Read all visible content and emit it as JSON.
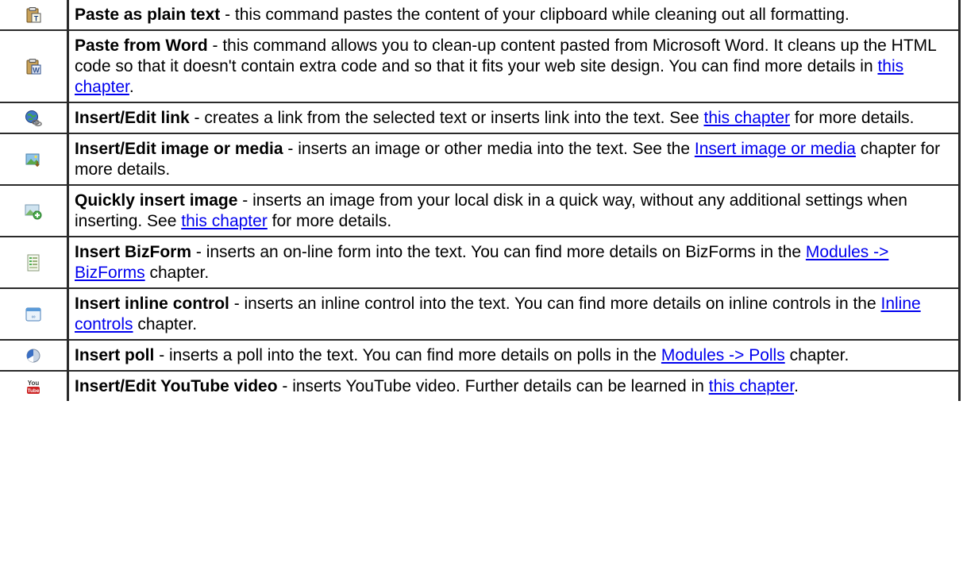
{
  "rows": [
    {
      "icon": "paste-plain-text-icon",
      "title": "Paste as plain text",
      "segments": [
        {
          "t": " - this command pastes the content of your clipboard while cleaning out all formatting."
        }
      ]
    },
    {
      "icon": "paste-from-word-icon",
      "title": "Paste from Word",
      "segments": [
        {
          "t": " - this command allows you to clean-up content pasted from Microsoft Word. It cleans up the HTML code so that it doesn't contain extra code and so that it fits your web site design. You can find more details in "
        },
        {
          "link": "this chapter"
        },
        {
          "t": "."
        }
      ]
    },
    {
      "icon": "insert-link-icon",
      "title": "Insert/Edit link",
      "segments": [
        {
          "t": " - creates a link from the selected text or inserts link into the text. See "
        },
        {
          "link": "this chapter"
        },
        {
          "t": " for more details."
        }
      ]
    },
    {
      "icon": "insert-image-media-icon",
      "title": "Insert/Edit image or media",
      "segments": [
        {
          "t": " - inserts an image or other media into the text. See the "
        },
        {
          "link": "Insert image or media"
        },
        {
          "t": " chapter for more details."
        }
      ]
    },
    {
      "icon": "quick-insert-image-icon",
      "title": "Quickly insert image",
      "segments": [
        {
          "t": " - inserts an image from your local disk in a quick way, without any additional settings when inserting. See "
        },
        {
          "link": "this chapter"
        },
        {
          "t": " for more details."
        }
      ]
    },
    {
      "icon": "bizform-icon",
      "title": "Insert BizForm",
      "segments": [
        {
          "t": " - inserts an on-line form into the text. You can find more details on BizForms in the "
        },
        {
          "link": "Modules -> BizForms"
        },
        {
          "t": " chapter."
        }
      ]
    },
    {
      "icon": "inline-control-icon",
      "title": "Insert inline control",
      "segments": [
        {
          "t": " - inserts an inline control into the text. You can find more details on inline controls in  the "
        },
        {
          "link": "Inline controls"
        },
        {
          "t": " chapter."
        }
      ]
    },
    {
      "icon": "poll-icon",
      "title": "Insert poll",
      "segments": [
        {
          "t": " - inserts a poll into the text. You can find more details on polls in the "
        },
        {
          "link": "Modules -> Polls"
        },
        {
          "t": " chapter."
        }
      ]
    },
    {
      "icon": "youtube-icon",
      "title": "Insert/Edit YouTube video",
      "segments": [
        {
          "t": " - inserts YouTube video. Further details can be learned in "
        },
        {
          "link": "this chapter"
        },
        {
          "t": "."
        }
      ]
    }
  ],
  "youtube_icon_text": {
    "top": "You",
    "bottom": "Tube"
  }
}
